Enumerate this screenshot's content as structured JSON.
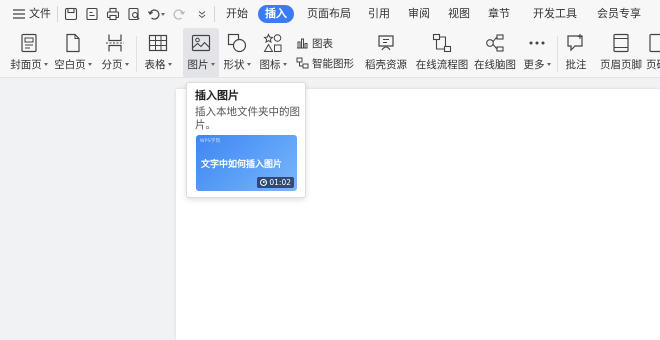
{
  "menubar": {
    "file_label": "文件",
    "tabs": [
      {
        "label": "开始",
        "active": false
      },
      {
        "label": "插入",
        "active": true
      },
      {
        "label": "页面布局",
        "active": false
      },
      {
        "label": "引用",
        "active": false
      },
      {
        "label": "审阅",
        "active": false
      },
      {
        "label": "视图",
        "active": false
      },
      {
        "label": "章节",
        "active": false
      },
      {
        "label": "开发工具",
        "active": false
      },
      {
        "label": "会员专享",
        "active": false
      }
    ]
  },
  "ribbon": {
    "cover_page": "封面页",
    "blank_page": "空白页",
    "page_break": "分页",
    "table": "表格",
    "picture": "图片",
    "shapes": "形状",
    "icons": "图标",
    "chart": "图表",
    "smart_art": "智能图形",
    "resources": "稻壳资源",
    "flowchart": "在线流程图",
    "mindmap": "在线脑图",
    "more": "更多",
    "comment": "批注",
    "header_footer": "页眉页脚",
    "page_number": "页码"
  },
  "tooltip": {
    "title": "插入图片",
    "description": "插入本地文件夹中的图片。",
    "video_brand": "WPS学院",
    "video_title": "文字中如何插入图片",
    "video_duration": "01:02"
  },
  "colors": {
    "accent": "#3b7cf6",
    "ribbon_bg": "#f7f7f8",
    "workspace_bg": "#f1f2f4"
  }
}
